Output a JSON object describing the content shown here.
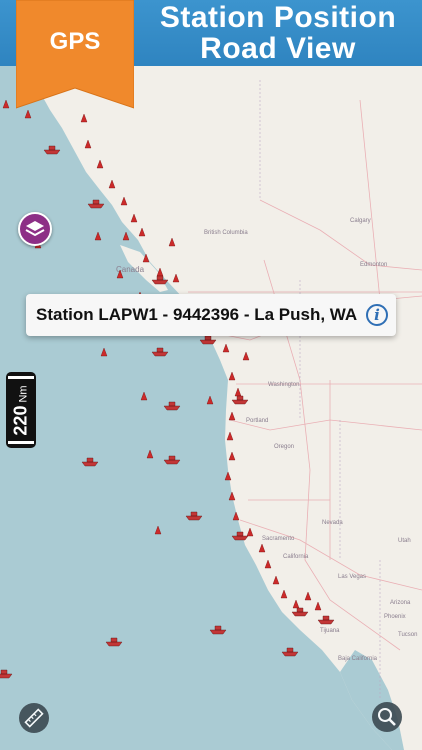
{
  "banner": {
    "title_line1": "Station Position",
    "title_line2": "Road View",
    "badge": "GPS"
  },
  "callout": {
    "text": "Station LAPW1 - 9442396 - La Push, WA",
    "info_glyph": "i"
  },
  "scale": {
    "value": "220",
    "unit": "Nm"
  },
  "map_labels": {
    "british_columbia": "British Columbia",
    "calgary": "Calgary",
    "edmonton": "Edmonton",
    "canada": "Canada",
    "washington": "Washington",
    "portland": "Portland",
    "oregon": "Oregon",
    "nevada": "Nevada",
    "sacramento": "Sacramento",
    "california": "California",
    "utah": "Utah",
    "las_vegas": "Las Vegas",
    "arizona": "Arizona",
    "phoenix": "Phoenix",
    "tucson": "Tucson",
    "tijuana": "Tijuana",
    "baja_california": "Baja California"
  },
  "colors": {
    "banner": "#2f84c0",
    "ribbon": "#f0892c",
    "land": "#f2efe9",
    "water": "#aacbd3",
    "marker": "#cc2a2a",
    "layers_button": "#8d2f86",
    "info_icon": "#2f6fb5"
  },
  "icons": {
    "layers": "layers-icon",
    "info": "info-icon",
    "ruler": "ruler-icon",
    "search": "search-icon",
    "buoy": "buoy-marker-icon",
    "ship": "ship-marker-icon"
  }
}
